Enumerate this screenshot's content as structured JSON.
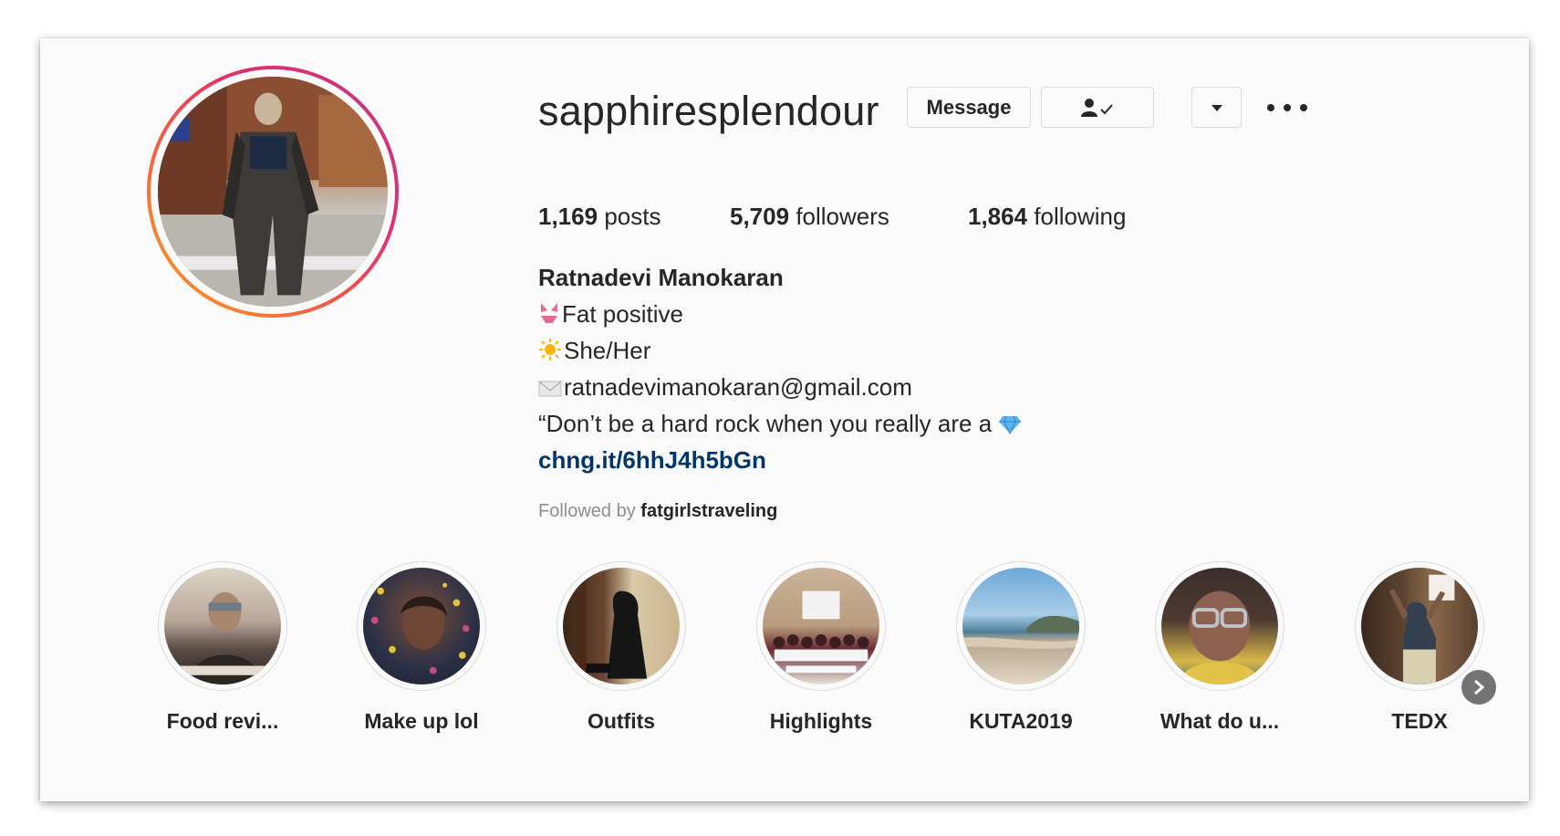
{
  "profile": {
    "username": "sapphiresplendour",
    "message_label": "Message",
    "follow_icon": "person-check-icon",
    "dropdown_icon": "caret-down-icon",
    "more_icon": "more-options-icon"
  },
  "stats": {
    "posts_count": "1,169",
    "posts_label": "posts",
    "followers_count": "5,709",
    "followers_label": "followers",
    "following_count": "1,864",
    "following_label": "following"
  },
  "bio": {
    "name": "Ratnadevi Manokaran",
    "line1": "Fat positive",
    "line2": "She/Her",
    "line3": "ratnadevimanokaran@gmail.com",
    "line4": "“Don’t be a hard rock when you really are a",
    "link": "chng.it/6hhJ4h5bGn",
    "followed_prefix": "Followed by",
    "followed_user": "fatgirlstraveling"
  },
  "highlights": [
    {
      "label": "Food revi..."
    },
    {
      "label": "Make up lol"
    },
    {
      "label": "Outfits"
    },
    {
      "label": "Highlights"
    },
    {
      "label": "KUTA2019"
    },
    {
      "label": "What do u..."
    },
    {
      "label": "TEDX"
    }
  ],
  "colors": {
    "link": "#00376b",
    "ring_gradient_start": "#f5a623",
    "ring_gradient_end": "#c13584"
  }
}
